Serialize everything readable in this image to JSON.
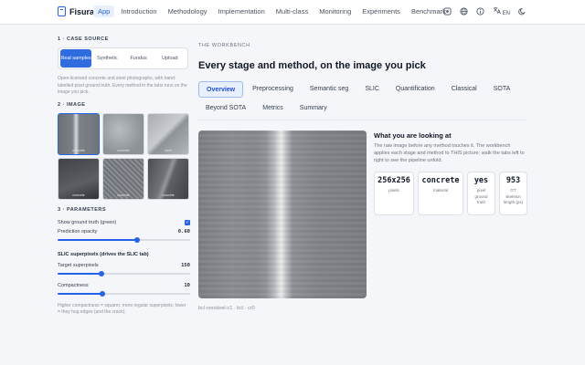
{
  "app": {
    "name": "Fisura"
  },
  "nav": {
    "links": [
      "App",
      "Introduction",
      "Methodology",
      "Implementation",
      "Multi-class",
      "Monitoring",
      "Experiments",
      "Benchmark"
    ],
    "active": "App",
    "lang": "EN"
  },
  "sidebar": {
    "case_source": {
      "title": "1 · CASE SOURCE",
      "options": [
        "Real samples",
        "Synthetic",
        "Fundus",
        "Upload"
      ],
      "selected": "Real samples",
      "description": "Open-licensed concrete and steel photographs, with hand-labelled pixel ground truth. Every method in the tabs runs on the image you pick."
    },
    "image": {
      "title": "2 · IMAGE",
      "thumbnails": [
        "concrete",
        "concrete",
        "steel",
        "concrete",
        "concrete",
        "concrete"
      ],
      "selected_index": 0
    },
    "parameters": {
      "title": "3 · PARAMETERS",
      "show_gt_label": "Show ground truth (green)",
      "show_gt_checked": true,
      "opacity_label": "Prediction opacity",
      "opacity_value": "0.60",
      "opacity_fraction": 0.6,
      "slic_title": "SLIC superpixels (drives the SLIC tab)",
      "superpixels_label": "Target superpixels",
      "superpixels_value": "150",
      "superpixels_fraction": 0.33,
      "compactness_label": "Compactness",
      "compactness_value": "10",
      "compactness_fraction": 0.34,
      "help": "Higher compactness = squarer, more regular superpixels; lower = they hug edges (and the crack)."
    }
  },
  "main": {
    "eyebrow": "THE WORKBENCH",
    "headline": "Every stage and method, on the image you pick",
    "tabs": [
      "Overview",
      "Preprocessing",
      "Semantic seg",
      "SLIC",
      "Quantification",
      "Classical",
      "SOTA",
      "Beyond SOTA",
      "Metrics",
      "Summary"
    ],
    "active_tab": "Overview",
    "view_caption": "bcl-nonsteel-c1 · bcl · cr0",
    "info": {
      "title": "What you are looking at",
      "description": "The raw image before any method touches it. The workbench applies each stage and method to THIS picture; walk the tabs left to right to see the pipeline unfold."
    },
    "stats": [
      {
        "value": "256x256",
        "label": "pixels"
      },
      {
        "value": "concrete",
        "label": "material"
      },
      {
        "value": "yes",
        "label": "pixel ground truth"
      },
      {
        "value": "953",
        "label": "GT skeleton length (px)"
      }
    ]
  },
  "colors": {
    "accent": "#2563eb",
    "background": "#f4f6f9"
  }
}
